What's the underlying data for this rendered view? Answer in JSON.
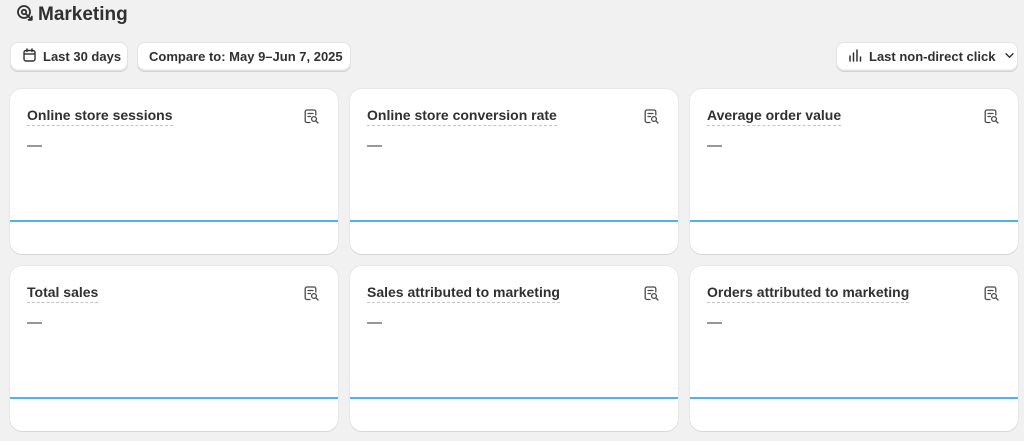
{
  "header": {
    "title": "Marketing",
    "icon": "marketing-target-icon"
  },
  "toolbar": {
    "date_range_label": "Last 30 days",
    "date_range_icon": "calendar-icon",
    "compare_label": "Compare to: May 9–Jun 7, 2025",
    "attribution_label": "Last non-direct click",
    "attribution_icon": "bar-chart-icon",
    "attribution_chevron_icon": "chevron-down-icon"
  },
  "colors": {
    "background": "#f1f1f1",
    "card": "#ffffff",
    "chart_line": "#4db5ec",
    "text": "#303030"
  },
  "cards": [
    {
      "title": "Online store sessions",
      "value": "—",
      "icon": "report-search-icon"
    },
    {
      "title": "Online store conversion rate",
      "value": "—",
      "icon": "report-search-icon"
    },
    {
      "title": "Average order value",
      "value": "—",
      "icon": "report-search-icon"
    },
    {
      "title": "Total sales",
      "value": "—",
      "icon": "report-search-icon"
    },
    {
      "title": "Sales attributed to marketing",
      "value": "—",
      "icon": "report-search-icon"
    },
    {
      "title": "Orders attributed to marketing",
      "value": "—",
      "icon": "report-search-icon"
    }
  ]
}
